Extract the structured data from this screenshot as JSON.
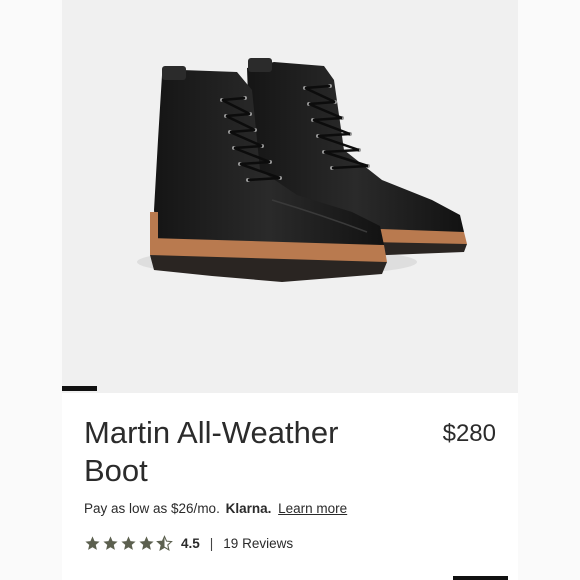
{
  "product": {
    "name": "Martin All-Weather Boot",
    "price": "$280",
    "image_alt": "Pair of black leather lace-up boots with tan leather soles",
    "colors": {
      "leather": "#1d1d1d",
      "welt": "#b97a4f",
      "outsole": "#2a2522",
      "background": "#f0f0f0"
    }
  },
  "financing": {
    "prefix": "Pay as low as $26/mo.",
    "provider": "Klarna.",
    "link": "Learn more"
  },
  "rating": {
    "value": "4.5",
    "score": 4.5,
    "max": 5,
    "separator": "|",
    "reviews": "19 Reviews",
    "star_color": "#5c604f"
  },
  "gallery": {
    "active_slide": 1
  }
}
